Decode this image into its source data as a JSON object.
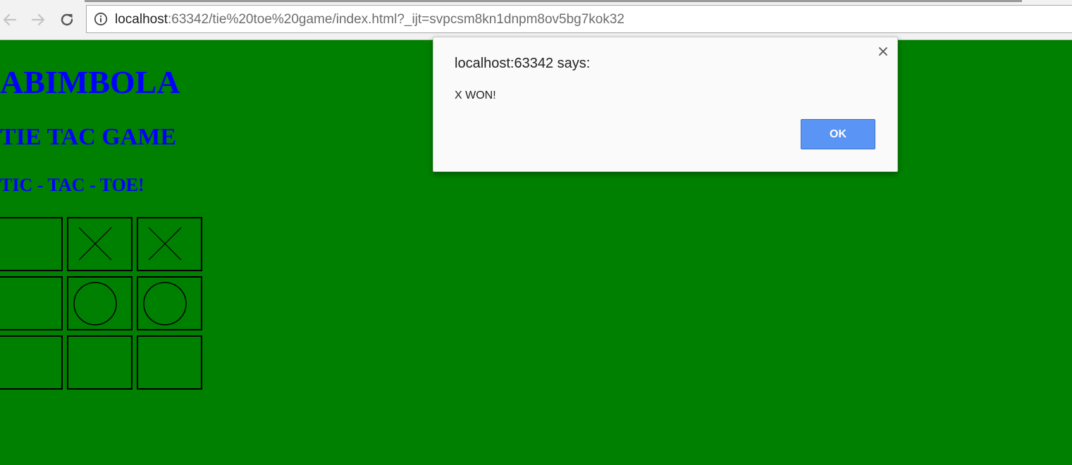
{
  "browser": {
    "url_host": "localhost",
    "url_rest": ":63342/tie%20toe%20game/index.html?_ijt=svpcsm8kn1dnpm8ov5bg7kok32",
    "back_icon": "arrow-left-icon",
    "forward_icon": "arrow-right-icon",
    "reload_icon": "reload-icon",
    "info_icon": "info-icon"
  },
  "page": {
    "background_color": "#008000",
    "heading_color": "#0000ff",
    "heading1": "ABIMBOLA",
    "heading2": "TIE TAC GAME",
    "heading3": "TIC - TAC - TOE!"
  },
  "board": {
    "cells": [
      "",
      "X",
      "X",
      "",
      "O",
      "O",
      "",
      "",
      ""
    ]
  },
  "dialog": {
    "title": "localhost:63342 says:",
    "message": "X WON!",
    "ok_label": "OK",
    "close_icon": "close-icon",
    "ok_color": "#5a95f5"
  }
}
